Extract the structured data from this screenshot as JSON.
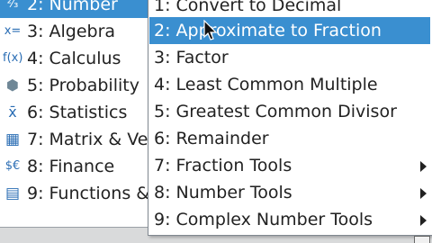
{
  "main_menu": {
    "items": [
      {
        "label": "2: Number",
        "icon": "number-icon",
        "glyph": "²⁄₃",
        "selected": true
      },
      {
        "label": "3: Algebra",
        "icon": "algebra-icon",
        "glyph": "x=",
        "selected": false
      },
      {
        "label": "4: Calculus",
        "icon": "calculus-icon",
        "glyph": "f(x)",
        "selected": false
      },
      {
        "label": "5: Probability",
        "icon": "probability-icon",
        "glyph": "⬢",
        "selected": false
      },
      {
        "label": "6: Statistics",
        "icon": "statistics-icon",
        "glyph": "x̄",
        "selected": false
      },
      {
        "label": "7: Matrix & Ve",
        "icon": "matrix-icon",
        "glyph": "▦",
        "selected": false
      },
      {
        "label": "8: Finance",
        "icon": "finance-icon",
        "glyph": "$€",
        "selected": false
      },
      {
        "label": "9: Functions &",
        "icon": "functions-icon",
        "glyph": "▤",
        "selected": false
      }
    ]
  },
  "sub_menu": {
    "items": [
      {
        "label": "1: Convert to Decimal",
        "has_submenu": false,
        "selected": false
      },
      {
        "label": "2: Approximate to Fraction",
        "has_submenu": false,
        "selected": true
      },
      {
        "label": "3: Factor",
        "has_submenu": false,
        "selected": false
      },
      {
        "label": "4: Least Common Multiple",
        "has_submenu": false,
        "selected": false
      },
      {
        "label": "5: Greatest Common Divisor",
        "has_submenu": false,
        "selected": false
      },
      {
        "label": "6: Remainder",
        "has_submenu": false,
        "selected": false
      },
      {
        "label": "7: Fraction Tools",
        "has_submenu": true,
        "selected": false
      },
      {
        "label": "8: Number Tools",
        "has_submenu": true,
        "selected": false
      },
      {
        "label": "9: Complex Number Tools",
        "has_submenu": true,
        "selected": false
      }
    ]
  },
  "colors": {
    "highlight": "#3a8fd0",
    "icon": "#2a6db4"
  }
}
